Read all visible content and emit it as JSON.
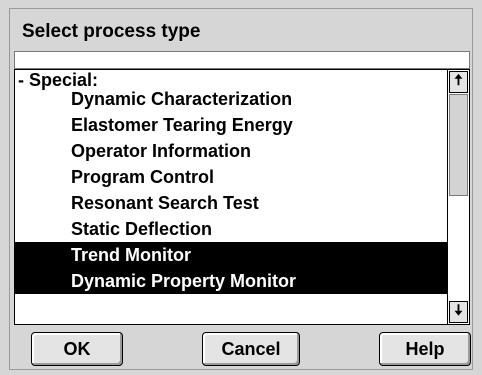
{
  "dialog": {
    "title": "Select process type"
  },
  "list": {
    "group_label": "- Special:",
    "items": [
      {
        "label": "Dynamic Characterization",
        "selected": false
      },
      {
        "label": "Elastomer Tearing Energy",
        "selected": false
      },
      {
        "label": "Operator Information",
        "selected": false
      },
      {
        "label": "Program Control",
        "selected": false
      },
      {
        "label": "Resonant Search Test",
        "selected": false
      },
      {
        "label": "Static Deflection",
        "selected": false
      },
      {
        "label": "Trend Monitor",
        "selected": true
      },
      {
        "label": "Dynamic Property Monitor",
        "selected": true
      }
    ]
  },
  "scrollbar": {
    "up_icon": "arrow-up-icon",
    "down_icon": "arrow-down-icon",
    "up_glyph": "🠅",
    "down_glyph": "🠇"
  },
  "buttons": {
    "ok": "OK",
    "cancel": "Cancel",
    "help": "Help"
  },
  "colors": {
    "selection_bg": "#000000",
    "selection_fg": "#ffffff",
    "dialog_bg": "#d6d6d6"
  }
}
